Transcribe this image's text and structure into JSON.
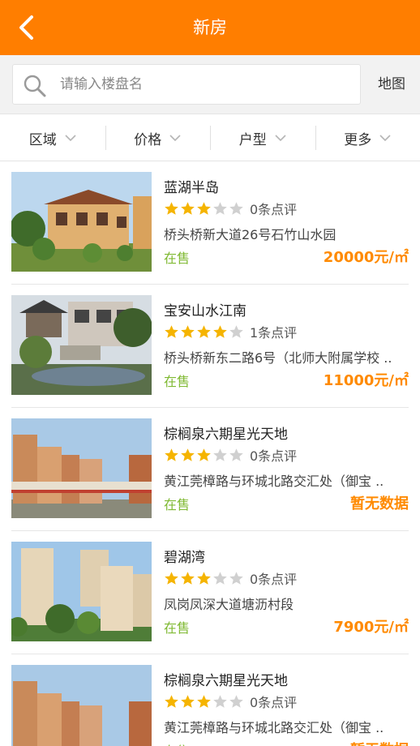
{
  "header": {
    "title": "新房"
  },
  "search": {
    "placeholder": "请输入楼盘名",
    "map_label": "地图"
  },
  "filters": [
    {
      "label": "区域"
    },
    {
      "label": "价格"
    },
    {
      "label": "户型"
    },
    {
      "label": "更多"
    }
  ],
  "colors": {
    "accent": "#ff7e00",
    "status_green": "#7fb932",
    "price_orange": "#ff8a00",
    "star_gold": "#f5b400",
    "star_gray": "#d0d0d0"
  },
  "listings": [
    {
      "name": "蓝湖半岛",
      "stars": 3,
      "reviews": "0条点评",
      "address": "桥头桥新大道26号石竹山水园",
      "status": "在售",
      "price": "20000元/㎡",
      "image": "villa-photo"
    },
    {
      "name": "宝安山水江南",
      "stars": 4,
      "reviews": "1条点评",
      "address": "桥头桥新东二路6号（北师大附属学校 ..",
      "status": "在售",
      "price": "11000元/㎡",
      "image": "garden-pavilion-photo"
    },
    {
      "name": "棕榈泉六期星光天地",
      "stars": 3,
      "reviews": "0条点评",
      "address": "黄江莞樟路与环城北路交汇处（御宝 ..",
      "status": "在售",
      "price": "暂无数据",
      "image": "commercial-complex-photo"
    },
    {
      "name": "碧湖湾",
      "stars": 3,
      "reviews": "0条点评",
      "address": "凤岗凤深大道塘沥村段",
      "status": "在售",
      "price": "7900元/㎡",
      "image": "apartment-towers-photo"
    },
    {
      "name": "棕榈泉六期星光天地",
      "stars": 3,
      "reviews": "0条点评",
      "address": "黄江莞樟路与环城北路交汇处（御宝 ..",
      "status": "在售",
      "price": "暂无数据",
      "image": "commercial-complex-photo"
    }
  ]
}
